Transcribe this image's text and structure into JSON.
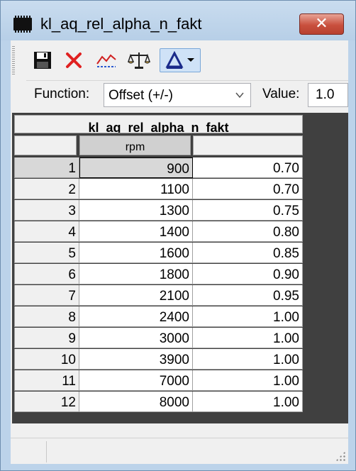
{
  "window": {
    "title": "kl_aq_rel_alpha_n_fakt",
    "close_symbol": "✕",
    "icon": "chip-icon"
  },
  "toolbar": {
    "buttons": [
      {
        "name": "save",
        "icon": "floppy-disk-icon"
      },
      {
        "name": "delete",
        "icon": "red-x-icon"
      },
      {
        "name": "graph",
        "icon": "line-graph-icon"
      },
      {
        "name": "compare",
        "icon": "balance-scale-icon"
      },
      {
        "name": "function",
        "icon": "triangle-dropdown-icon"
      }
    ]
  },
  "function_row": {
    "function_label": "Function:",
    "function_value": "Offset (+/-)",
    "value_label": "Value:",
    "value": "1.0"
  },
  "table": {
    "title": "kl_aq_rel_alpha_n_fakt",
    "column_header": "rpm",
    "value_header": "",
    "rows": [
      {
        "index": "1",
        "rpm": "900",
        "value": "0.70"
      },
      {
        "index": "2",
        "rpm": "1100",
        "value": "0.70"
      },
      {
        "index": "3",
        "rpm": "1300",
        "value": "0.75"
      },
      {
        "index": "4",
        "rpm": "1400",
        "value": "0.80"
      },
      {
        "index": "5",
        "rpm": "1600",
        "value": "0.85"
      },
      {
        "index": "6",
        "rpm": "1800",
        "value": "0.90"
      },
      {
        "index": "7",
        "rpm": "2100",
        "value": "0.95"
      },
      {
        "index": "8",
        "rpm": "2400",
        "value": "1.00"
      },
      {
        "index": "9",
        "rpm": "3000",
        "value": "1.00"
      },
      {
        "index": "10",
        "rpm": "3900",
        "value": "1.00"
      },
      {
        "index": "11",
        "rpm": "7000",
        "value": "1.00"
      },
      {
        "index": "12",
        "rpm": "8000",
        "value": "1.00"
      }
    ]
  },
  "colors": {
    "title_bar": "#bcd3ea",
    "close_button": "#c9503e",
    "grid_background": "#404040",
    "selected_cell": "#d8d8d8"
  }
}
